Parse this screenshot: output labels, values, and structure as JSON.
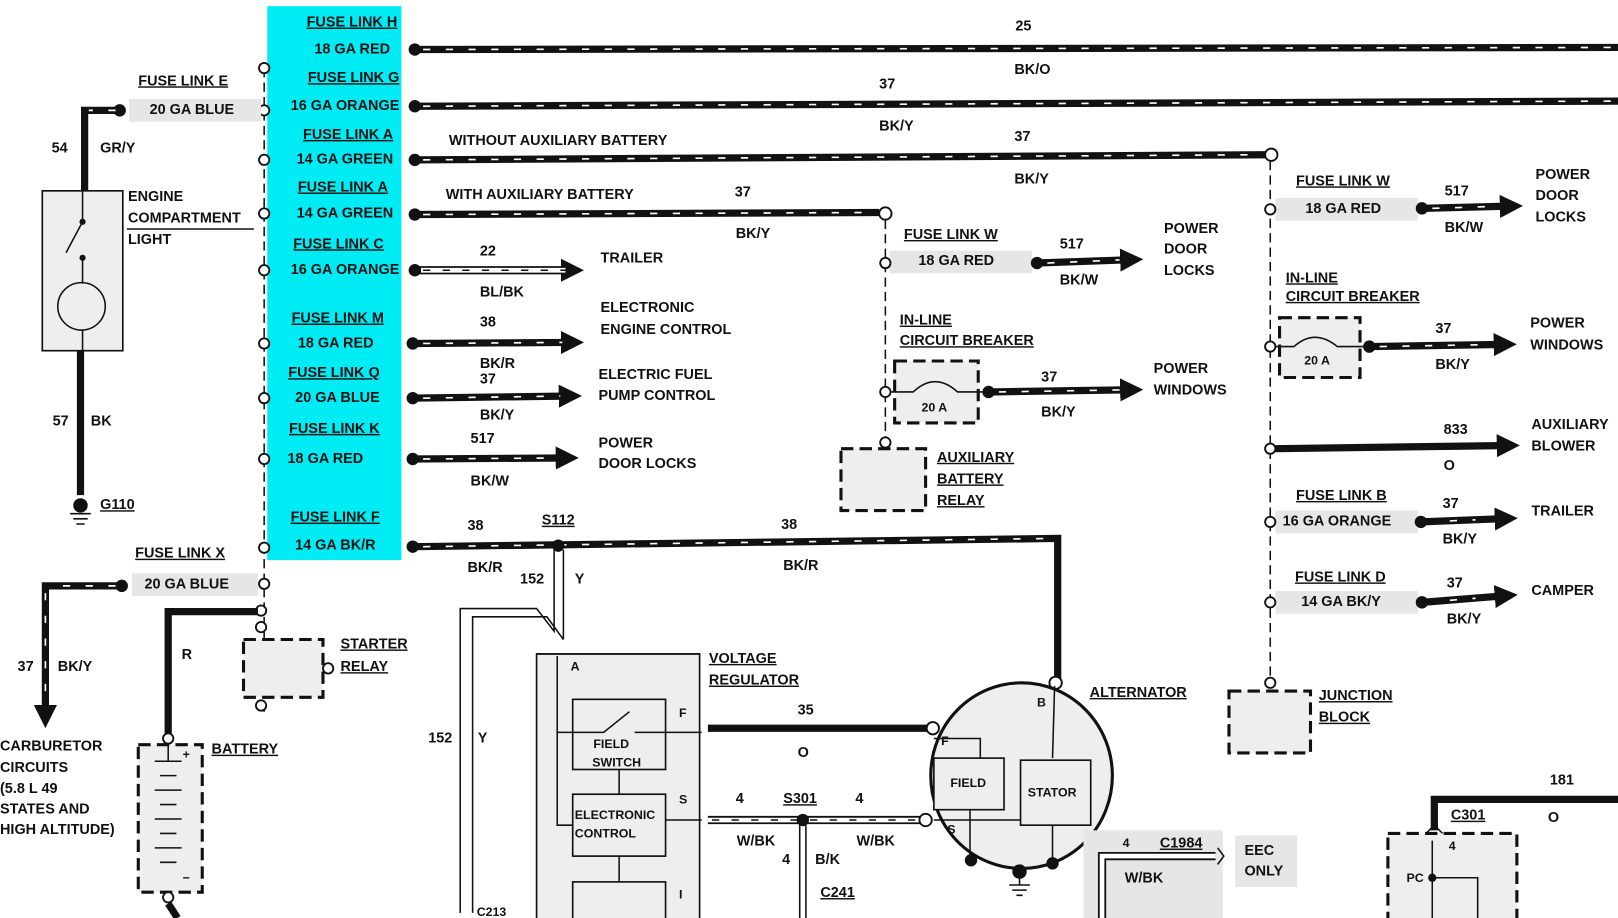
{
  "highlight_color": "#00ecf5",
  "fuse_block": {
    "rows": [
      {
        "link": "FUSE LINK H",
        "gauge": "18 GA RED",
        "circuit": "25",
        "color": "BK/O"
      },
      {
        "link": "FUSE LINK G",
        "gauge": "16 GA ORANGE",
        "circuit": "37",
        "color": "BK/Y"
      },
      {
        "link": "FUSE LINK A",
        "gauge": "14 GA GREEN",
        "circuit": "37",
        "color": "BK/Y",
        "note": "WITHOUT AUXILIARY BATTERY"
      },
      {
        "link": "FUSE LINK A",
        "gauge": "14 GA GREEN",
        "circuit": "37",
        "color": "BK/Y",
        "note": "WITH AUXILIARY BATTERY"
      },
      {
        "link": "FUSE LINK C",
        "gauge": "16 GA ORANGE",
        "circuit": "22",
        "color": "BL/BK",
        "dest": [
          "TRAILER"
        ]
      },
      {
        "link": "FUSE LINK M",
        "gauge": "18 GA RED",
        "circuit": "38",
        "color": "BK/R",
        "dest": [
          "ELECTRONIC",
          "ENGINE CONTROL"
        ]
      },
      {
        "link": "FUSE LINK Q",
        "gauge": "20 GA BLUE",
        "circuit": "37",
        "color": "BK/Y",
        "dest": [
          "ELECTRIC FUEL",
          "PUMP CONTROL"
        ]
      },
      {
        "link": "FUSE LINK K",
        "gauge": "18 GA RED",
        "circuit": "517",
        "color": "BK/W",
        "dest": [
          "POWER",
          "DOOR LOCKS"
        ]
      },
      {
        "link": "FUSE LINK F",
        "gauge": "14 GA BK/R",
        "circuit": "38",
        "color": "BK/R",
        "splice": "S112",
        "circuit2": "38",
        "color2": "BK/R"
      }
    ]
  },
  "left": {
    "fuse_e": {
      "link": "FUSE LINK E",
      "gauge": "20 GA BLUE",
      "circuit": "54",
      "color": "GR/Y"
    },
    "light": [
      "ENGINE",
      "COMPARTMENT",
      "LIGHT"
    ],
    "ground": {
      "circuit": "57",
      "color": "BK",
      "label": "G110"
    },
    "fuse_x": {
      "link": "FUSE LINK X",
      "gauge": "20 GA BLUE",
      "circuit": "37",
      "color": "BK/Y"
    },
    "carb": [
      "CARBURETOR",
      "CIRCUITS",
      "(5.8 L 49",
      "STATES AND",
      "HIGH ALTITUDE)"
    ],
    "battery": {
      "label": "BATTERY",
      "wire_color": "R",
      "plus": "+",
      "minus": "−"
    },
    "starter_relay": [
      "STARTER",
      "RELAY"
    ]
  },
  "aux_branch": {
    "fuse_w": {
      "link": "FUSE LINK W",
      "gauge": "18 GA RED",
      "circuit": "517",
      "color": "BK/W",
      "dest": [
        "POWER",
        "DOOR",
        "LOCKS"
      ]
    },
    "breaker": {
      "label": [
        "IN-LINE",
        "CIRCUIT BREAKER"
      ],
      "rating": "20 A",
      "circuit": "37",
      "color": "BK/Y",
      "dest": [
        "POWER",
        "WINDOWS"
      ]
    },
    "relay": [
      "AUXILIARY",
      "BATTERY",
      "RELAY"
    ]
  },
  "right_branch": {
    "fuse_w": {
      "link": "FUSE LINK W",
      "gauge": "18 GA RED",
      "circuit": "517",
      "color": "BK/W",
      "dest": [
        "POWER",
        "DOOR",
        "LOCKS"
      ]
    },
    "breaker": {
      "label": [
        "IN-LINE",
        "CIRCUIT BREAKER"
      ],
      "rating": "20 A",
      "circuit": "37",
      "color": "BK/Y",
      "dest": [
        "POWER",
        "WINDOWS"
      ]
    },
    "blower": {
      "circuit": "833",
      "color": "O",
      "dest": [
        "AUXILIARY",
        "BLOWER"
      ]
    },
    "fuse_b": {
      "link": "FUSE LINK B",
      "gauge": "16 GA ORANGE",
      "circuit": "37",
      "color": "BK/Y",
      "dest": "TRAILER"
    },
    "fuse_d": {
      "link": "FUSE LINK D",
      "gauge": "14 GA BK/Y",
      "circuit": "37",
      "color": "BK/Y",
      "dest": "CAMPER"
    },
    "junction": [
      "JUNCTION",
      "BLOCK"
    ]
  },
  "charging": {
    "y_wire": {
      "circuit": "152",
      "color": "Y",
      "circuit_b": "152",
      "color_b": "Y",
      "connector": "C213"
    },
    "regulator": {
      "label": [
        "VOLTAGE",
        "REGULATOR"
      ],
      "term_a": "A",
      "term_f": "F",
      "term_s": "S",
      "term_i": "I",
      "field_switch": [
        "FIELD",
        "SWITCH"
      ],
      "control": [
        "ELECTRONIC",
        "CONTROL"
      ]
    },
    "field_wire": {
      "circuit": "35",
      "color": "O"
    },
    "stator_wire": {
      "circuit": "4",
      "splice": "S301",
      "circuit2": "4",
      "color": "W/BK",
      "color2": "W/BK",
      "down_circuit": "4",
      "down_color": "B/K",
      "connector": "C241"
    },
    "alternator": {
      "label": "ALTERNATOR",
      "term_b": "B",
      "term_f": "F",
      "term_s": "S",
      "field": "FIELD",
      "stator": "STATOR"
    },
    "eec": {
      "circuit": "4",
      "connector": "C1984",
      "color": "W/BK",
      "note": [
        "EEC",
        "ONLY"
      ]
    },
    "c301": {
      "circuit": "181",
      "color": "O",
      "connector": "C301",
      "pin": "4",
      "pc": "PC"
    }
  }
}
